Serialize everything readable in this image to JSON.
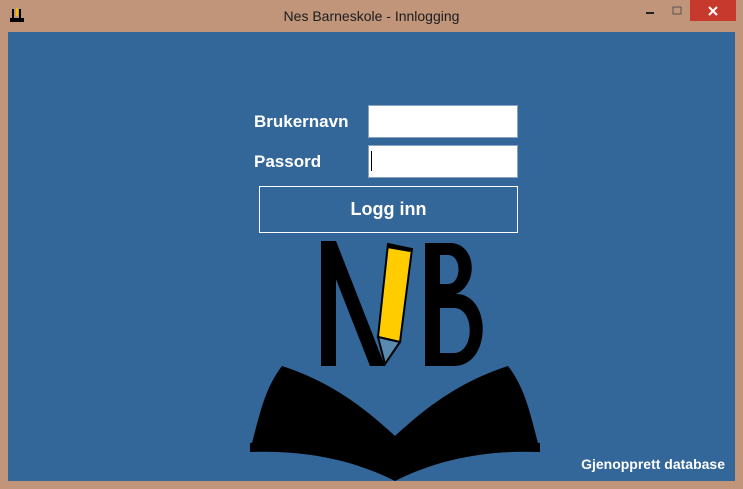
{
  "window": {
    "title": "Nes Barneskole - Innlogging",
    "icons": {
      "app": "app-icon",
      "minimize": "minimize-icon",
      "maximize": "maximize-icon",
      "close": "close-icon"
    }
  },
  "form": {
    "username_label": "Brukernavn",
    "username_value": "",
    "password_label": "Passord",
    "password_value": "",
    "login_button": "Logg inn"
  },
  "logo": {
    "name": "nb-logo",
    "text": "NB"
  },
  "footer": {
    "restore_link": "Gjenopprett database"
  },
  "colors": {
    "frame": "#c0957a",
    "background": "#336699",
    "close_button": "#c7392d",
    "pencil": "#ffcc00",
    "text": "#ffffff"
  }
}
